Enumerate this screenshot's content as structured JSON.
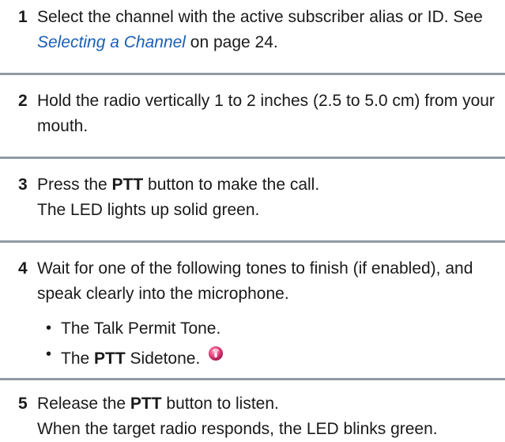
{
  "steps": [
    {
      "number": "1",
      "text_before": "Select the channel with the active subscriber alias or ID. See ",
      "link_text": "Selecting a Channel",
      "text_after": " on page 24."
    },
    {
      "number": "2",
      "text": "Hold the radio vertically 1 to 2 inches (2.5 to 5.0 cm) from your mouth."
    },
    {
      "number": "3",
      "text_before": "Press the ",
      "bold": "PTT",
      "text_after": " button to make the call.",
      "line2": "The LED lights up solid green."
    },
    {
      "number": "4",
      "text": "Wait for one of the following tones to finish (if enabled), and speak clearly into the microphone.",
      "bullets": [
        {
          "text": "The Talk Permit Tone."
        },
        {
          "text_before": "The ",
          "bold": "PTT",
          "text_after": " Sidetone."
        }
      ],
      "bullet_marker": "•"
    },
    {
      "number": "5",
      "text_before": "Release the ",
      "bold": "PTT",
      "text_after": " button to listen.",
      "line2": "When the target radio responds, the LED blinks green."
    }
  ],
  "colors": {
    "link": "#1a5fb4",
    "divider": "#8f9ba4",
    "icon": "#d6336c"
  },
  "icons": {
    "sidetone": "pink-radio-icon"
  }
}
